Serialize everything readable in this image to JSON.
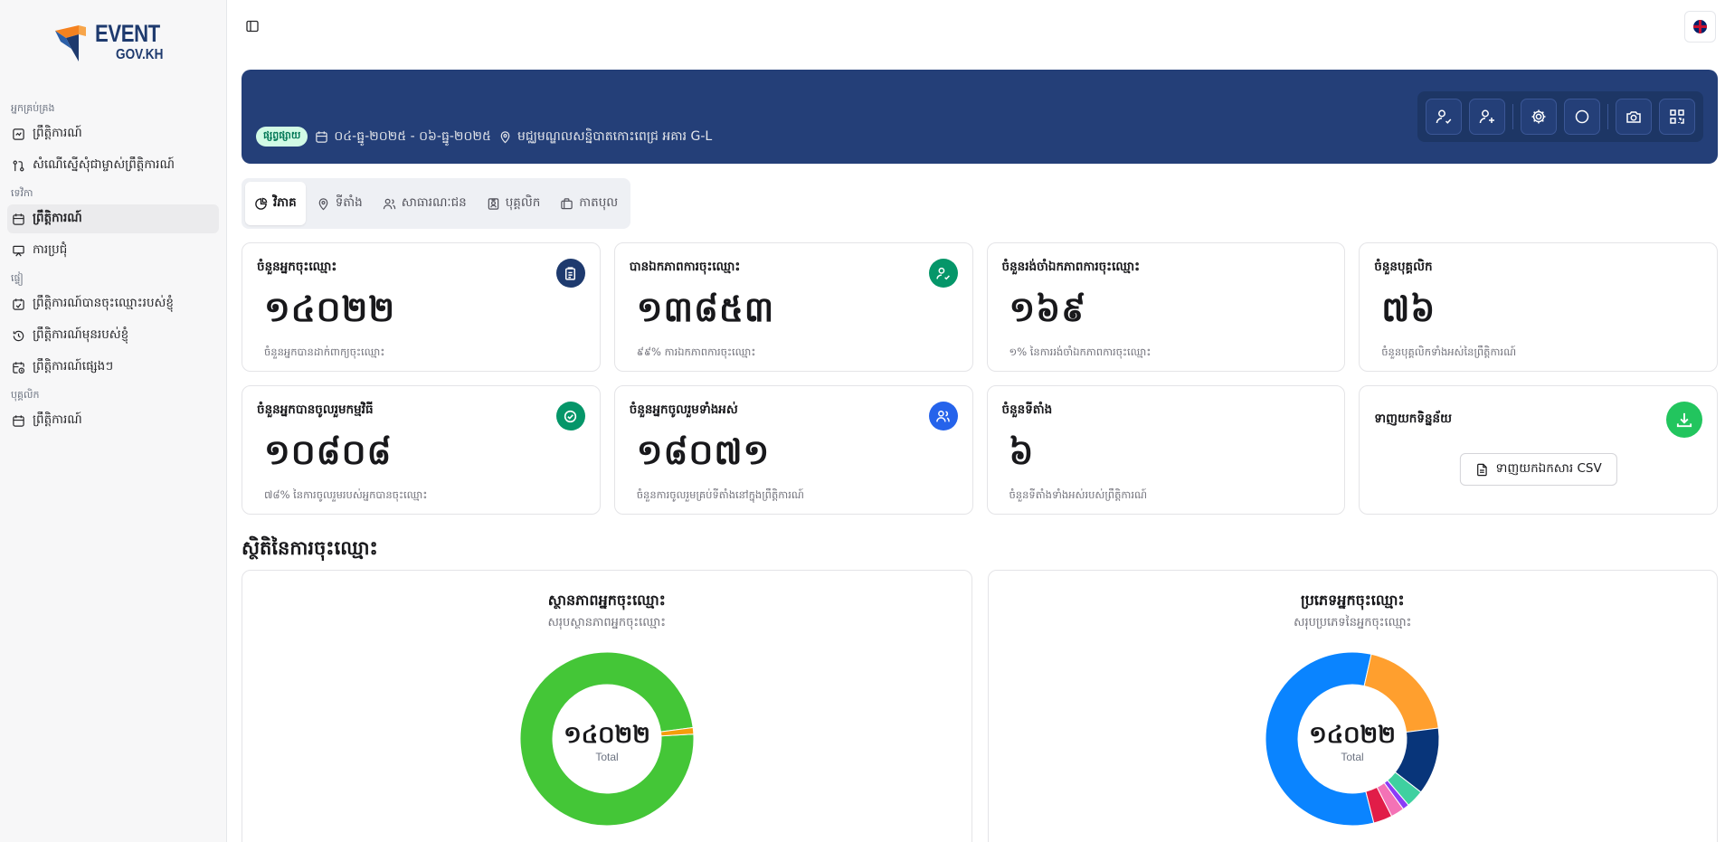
{
  "logo": {
    "line1": "EVENT",
    "line2": "GOV.KH"
  },
  "sidebar": {
    "groups": [
      {
        "label": "អ្នកគ្រប់គ្រង",
        "items": [
          {
            "label": "ព្រឹត្តិការណ៍",
            "icon": "event-icon"
          },
          {
            "label": "សំណើស្នើសុំជាម្ចាស់ព្រឹត្តិការណ៍",
            "icon": "request-icon"
          }
        ]
      },
      {
        "label": "ទេវិកា",
        "items": [
          {
            "label": "ព្រឹត្តិការណ៍",
            "icon": "calendar-icon",
            "active": true
          },
          {
            "label": "ការប្រជុំ",
            "icon": "meeting-icon"
          }
        ]
      },
      {
        "label": "ផ្ទៀ",
        "items": [
          {
            "label": "ព្រឹត្តិការណ៍បានចុះឈ្មោះរបស់ខ្ញុំ",
            "icon": "registered-icon"
          },
          {
            "label": "ព្រឹត្តិការណ៍មុនរបស់ខ្ញុំ",
            "icon": "history-icon"
          },
          {
            "label": "ព្រឹត្តិការណ៍ផ្សេងៗ",
            "icon": "calendar-clock-icon"
          }
        ]
      },
      {
        "label": "បុគ្គលិក",
        "items": [
          {
            "label": "ព្រឹត្តិការណ៍",
            "icon": "calendar-icon"
          }
        ]
      }
    ]
  },
  "banner": {
    "status": "ផ្សព្វផ្សាយ",
    "date_range": "០៤-ធ្នូ-២០២៥ - ០៦-ធ្នូ-២០២៥",
    "location": "មជ្ឈមណ្ឌលសន្និបាតកោះពេជ្រ អគារ G-L"
  },
  "tabs": [
    {
      "label": "វិភាគ",
      "icon": "chart-pie-icon",
      "active": true
    },
    {
      "label": "ទីតាំង",
      "icon": "map-pin-icon"
    },
    {
      "label": "សាធារណៈជន",
      "icon": "users-icon"
    },
    {
      "label": "បុគ្គលិក",
      "icon": "id-badge-icon"
    },
    {
      "label": "កាតបុល",
      "icon": "briefcase-icon"
    }
  ],
  "stats": [
    {
      "title": "ចំនួនអ្នកចុះឈ្មោះ",
      "value": "១៤០២២",
      "sub": "ចំនួនអ្នកបានដាក់ពាក្យចុះឈ្មោះ",
      "icon": "clipboard-icon",
      "color": "#1e3a6e"
    },
    {
      "title": "បានឯកភាពការចុះឈ្មោះ",
      "value": "១៣៨៥៣",
      "sub": "៩៩% ការឯកភាពការចុះឈ្មោះ",
      "icon": "user-check-icon",
      "color": "#059669"
    },
    {
      "title": "ចំនួនរង់ចាំឯកភាពការចុះឈ្មោះ",
      "value": "១៦៩",
      "sub": "១% នៃការរង់ចាំឯកភាពការចុះឈ្មោះ",
      "icon": "",
      "color": ""
    },
    {
      "title": "ចំនួនបុគ្គលិក",
      "value": "៧៦",
      "sub": "ចំនួនបុគ្គលិកទាំងអស់នៃព្រឹត្តិការណ៍",
      "icon": "",
      "color": ""
    },
    {
      "title": "ចំនួនអ្នកបានចូលរួមកម្មវិធី",
      "value": "១០៨០៨",
      "sub": "៧៨% នៃការចូលរួមរបស់អ្នកបានចុះឈ្មោះ",
      "icon": "check-circle-icon",
      "color": "#059669"
    },
    {
      "title": "ចំនួនអ្នកចូលរួមទាំងអស់",
      "value": "១៨០៧១",
      "sub": "ចំនួនការចូលរួមគ្រប់ទីតាំងនៅក្នុងព្រឹត្តិការណ៍",
      "icon": "users-icon",
      "color": "#2563eb"
    },
    {
      "title": "ចំនួនទីតាំង",
      "value": "៦",
      "sub": "ចំនួនទីតាំងទាំងអស់របស់ព្រឹត្តិការណ៍",
      "icon": "",
      "color": ""
    }
  ],
  "download": {
    "title": "ទាញយកទិន្នន័យ",
    "button": "ទាញយកឯកសារ CSV",
    "color": "#22c55e"
  },
  "section_title": "ស្ថិតិនៃការចុះឈ្មោះ",
  "chart_data": [
    {
      "type": "pie",
      "title": "ស្ថានភាពអ្នកចុះឈ្មោះ",
      "subtitle": "សរុបស្ថានភាពអ្នកចុះឈ្មោះ",
      "center_value": "១៤០២២",
      "center_label": "Total",
      "donut": true,
      "slices": [
        {
          "value": 13853,
          "color": "#44c637"
        },
        {
          "value": 169,
          "color": "#f59e0b"
        }
      ]
    },
    {
      "type": "pie",
      "title": "ប្រភេទអ្នកចុះឈ្មោះ",
      "subtitle": "សរុបប្រភេទនៃអ្នកចុះឈ្មោះ",
      "center_value": "១៤០២២",
      "center_label": "Total",
      "donut": true,
      "slices": [
        {
          "value": 57.5,
          "color": "#0a84ff"
        },
        {
          "value": 19.5,
          "color": "#ff9f2e"
        },
        {
          "value": 12.5,
          "color": "#08357a"
        },
        {
          "value": 3.3,
          "color": "#3fd0a0"
        },
        {
          "value": 1.2,
          "color": "#8b3cf7"
        },
        {
          "value": 2.5,
          "color": "#f472b6"
        },
        {
          "value": 3.5,
          "color": "#e11d48"
        }
      ]
    }
  ]
}
